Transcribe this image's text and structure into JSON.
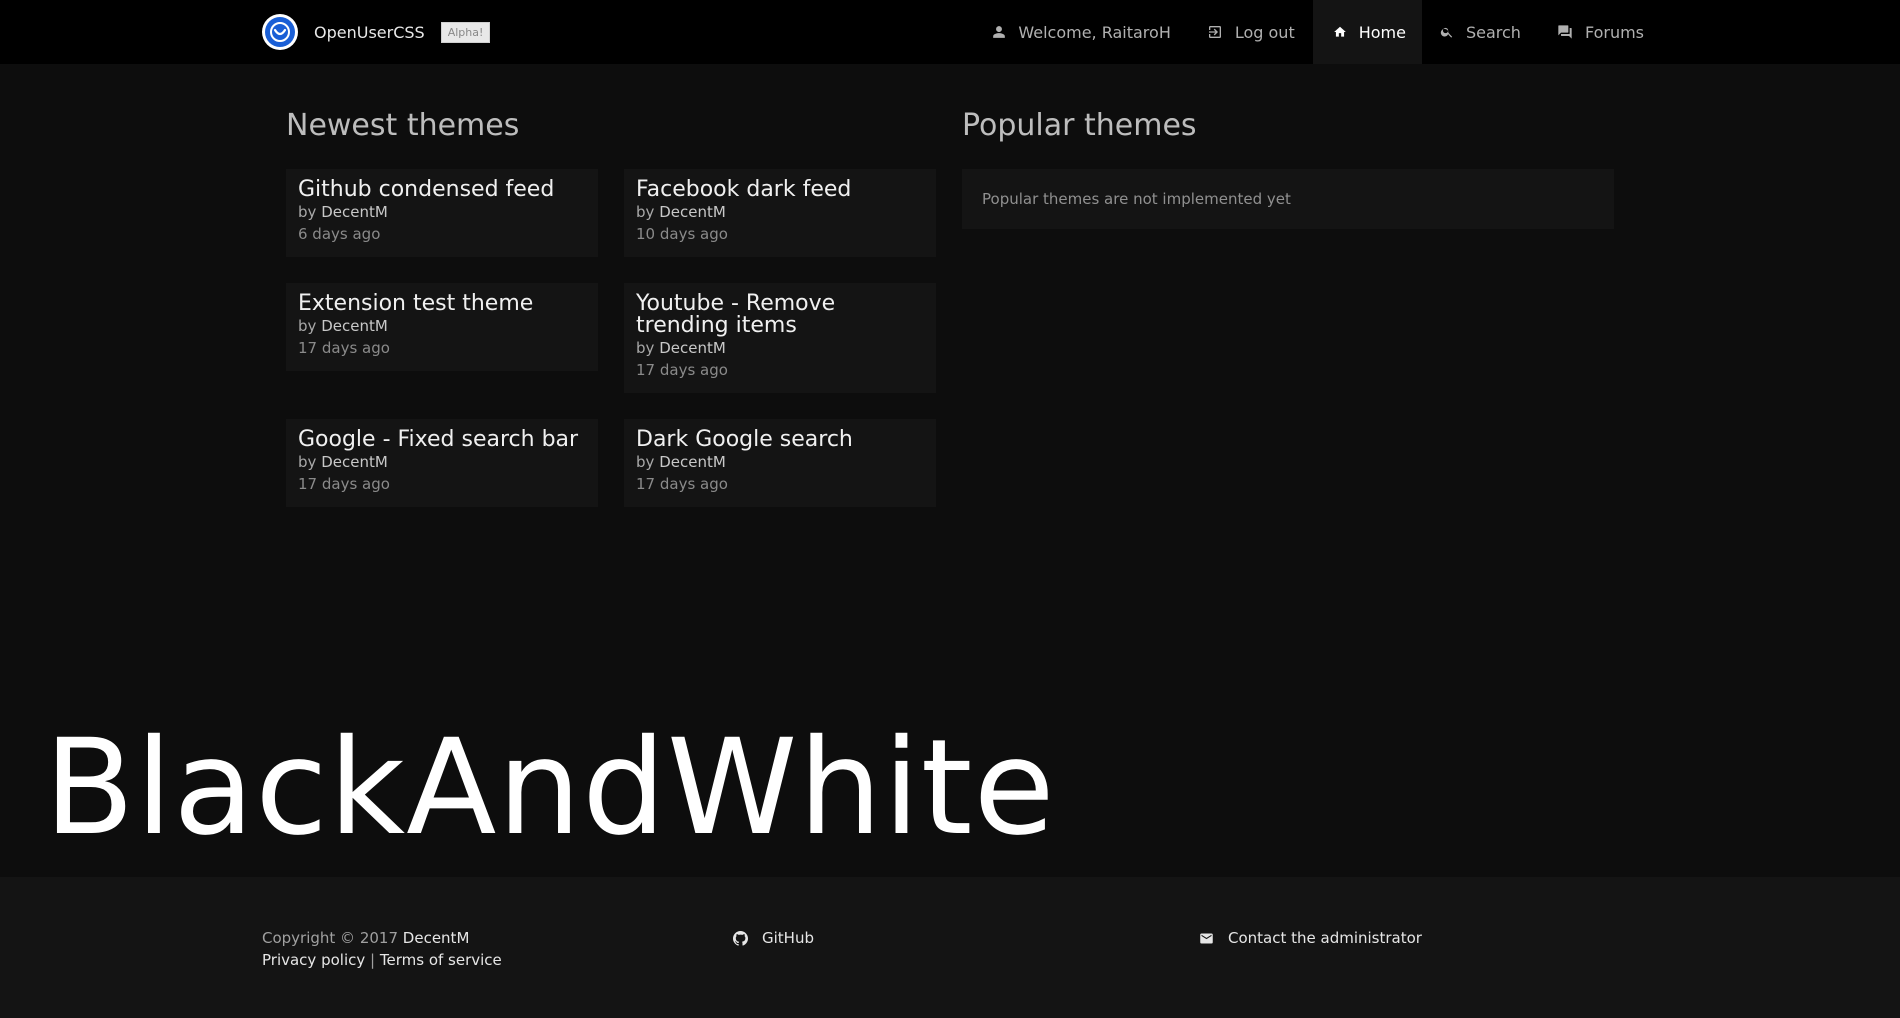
{
  "navbar": {
    "brand_name": "OpenUserCSS",
    "alpha_badge": "Alpha!",
    "items": [
      {
        "label": "Welcome, RaitaroH",
        "icon": "person-icon"
      },
      {
        "label": "Log out",
        "icon": "logout-icon"
      },
      {
        "label": "Home",
        "icon": "home-icon",
        "active": true
      },
      {
        "label": "Search",
        "icon": "search-icon"
      },
      {
        "label": "Forums",
        "icon": "forum-icon"
      }
    ]
  },
  "newest": {
    "title": "Newest themes",
    "themes": [
      {
        "title": "Github condensed feed",
        "by": "by",
        "author": "DecentM",
        "time": "6 days ago"
      },
      {
        "title": "Facebook dark feed",
        "by": "by",
        "author": "DecentM",
        "time": "10 days ago"
      },
      {
        "title": "Extension test theme",
        "by": "by",
        "author": "DecentM",
        "time": "17 days ago"
      },
      {
        "title_line1": "Youtube - Remove",
        "title_line2": "trending items",
        "by": "by",
        "author": "DecentM",
        "time": "17 days ago"
      },
      {
        "title": "Google - Fixed search bar",
        "by": "by",
        "author": "DecentM",
        "time": "17 days ago"
      },
      {
        "title": "Dark Google search",
        "by": "by",
        "author": "DecentM",
        "time": "17 days ago"
      }
    ]
  },
  "popular": {
    "title": "Popular themes",
    "message": "Popular themes are not implemented yet"
  },
  "overlay_text": "BlackAndWhite",
  "footer": {
    "copyright": "Copyright © 2017",
    "copyright_owner": "DecentM",
    "privacy": "Privacy policy",
    "separator": "|",
    "terms": "Terms of service",
    "github": "GitHub",
    "contact": "Contact the administrator"
  },
  "colors": {
    "background": "#0d0d0d",
    "navbar": "#000000",
    "card": "#141414",
    "logo_blue": "#1a5fd6"
  }
}
